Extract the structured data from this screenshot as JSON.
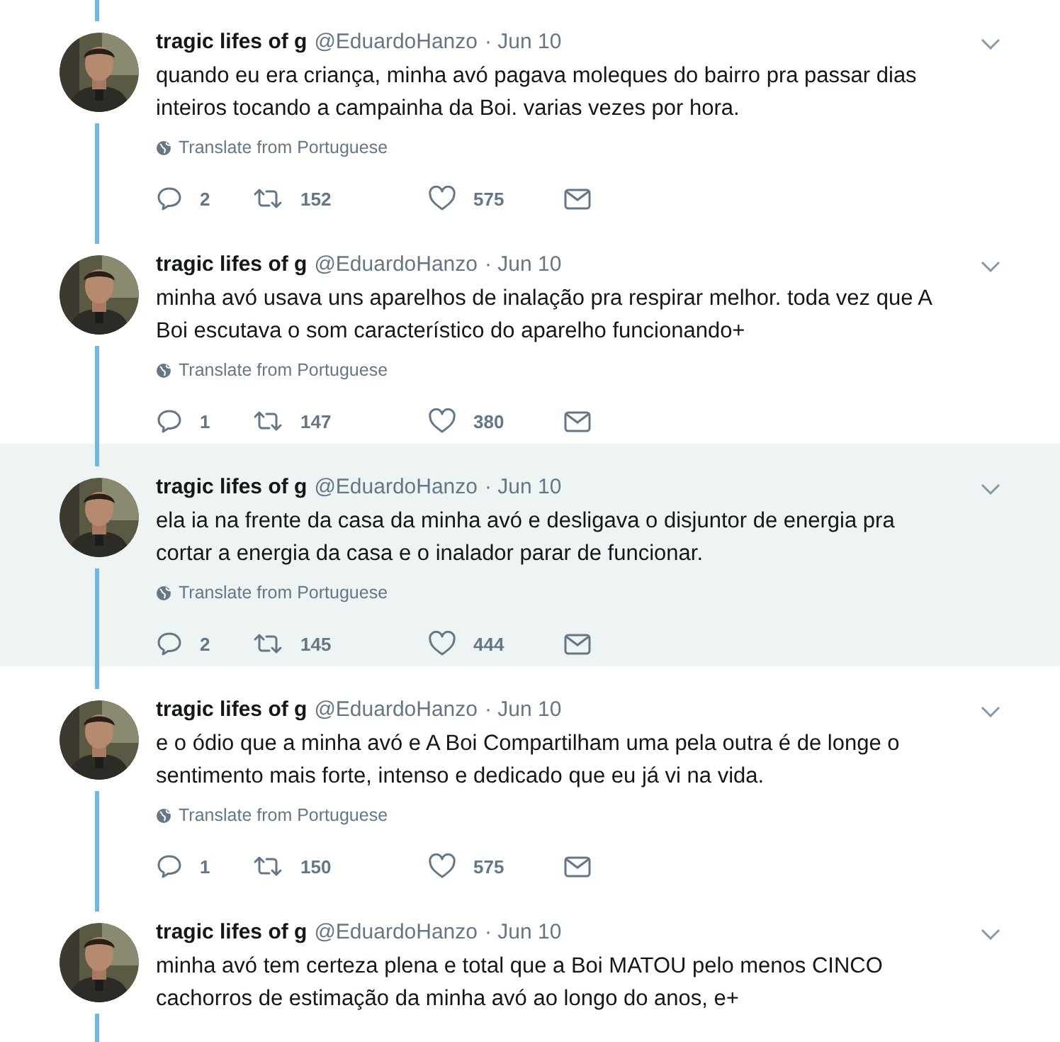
{
  "tweets": [
    {
      "name": "tragic lifes of g",
      "handle": "@EduardoHanzo",
      "date": "· Jun 10",
      "text": "quando eu era criança, minha avó pagava moleques do bairro pra passar dias inteiros tocando a campainha da Boi. varias vezes por hora.",
      "translate": "Translate from Portuguese",
      "replies": "2",
      "retweets": "152",
      "likes": "575",
      "highlighted": false
    },
    {
      "name": "tragic lifes of g",
      "handle": "@EduardoHanzo",
      "date": "· Jun 10",
      "text": "minha avó usava uns aparelhos de inalação pra respirar melhor. toda vez que A Boi escutava o som característico do aparelho funcionando+",
      "translate": "Translate from Portuguese",
      "replies": "1",
      "retweets": "147",
      "likes": "380",
      "highlighted": false
    },
    {
      "name": "tragic lifes of g",
      "handle": "@EduardoHanzo",
      "date": "· Jun 10",
      "text": "ela ia na frente da casa da minha avó e desligava o disjuntor de energia pra cortar a energia da casa e o inalador parar de funcionar.",
      "translate": "Translate from Portuguese",
      "replies": "2",
      "retweets": "145",
      "likes": "444",
      "highlighted": true
    },
    {
      "name": "tragic lifes of g",
      "handle": "@EduardoHanzo",
      "date": "· Jun 10",
      "text": "e o ódio que a minha avó e A Boi Compartilham uma pela outra é de longe o sentimento mais forte, intenso e dedicado que eu já vi na vida.",
      "translate": "Translate from Portuguese",
      "replies": "1",
      "retweets": "150",
      "likes": "575",
      "highlighted": false
    },
    {
      "name": "tragic lifes of g",
      "handle": "@EduardoHanzo",
      "date": "· Jun 10",
      "text": "minha avó tem certeza plena e total que a Boi MATOU pelo menos CINCO cachorros de estimação da minha avó ao longo do anos, e+",
      "highlighted": false
    }
  ]
}
